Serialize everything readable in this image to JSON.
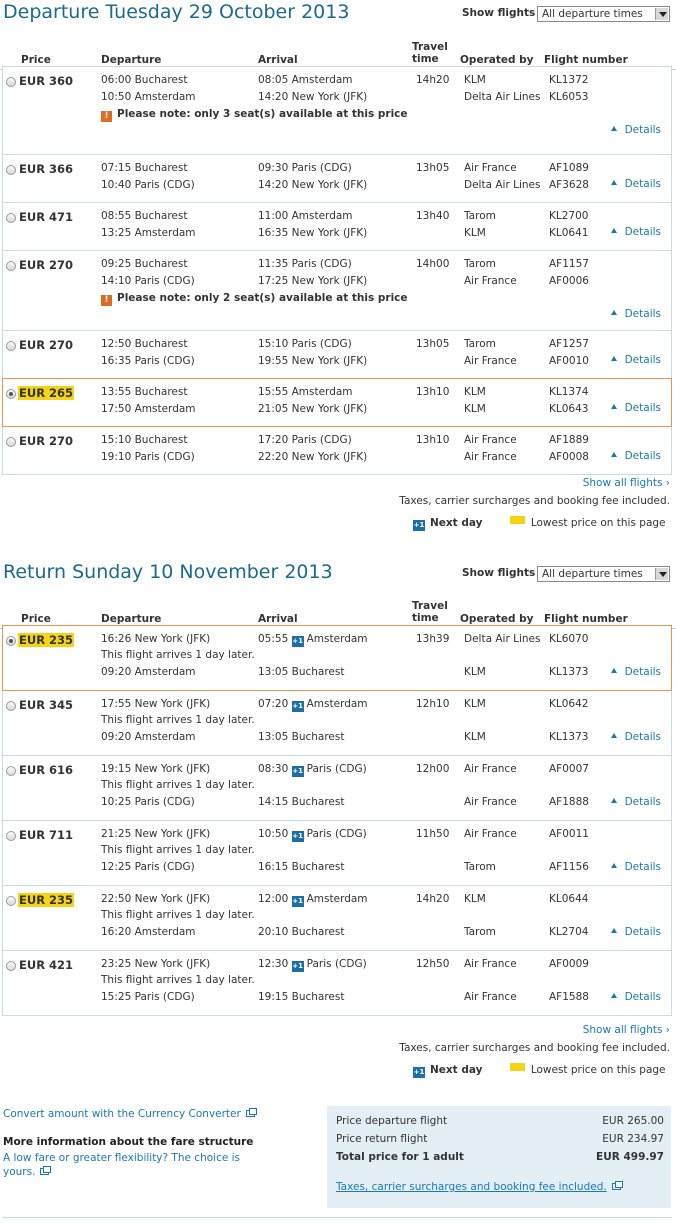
{
  "departure": {
    "title": "Departure Tuesday 29 October 2013",
    "show_flights_label": "Show flights",
    "select_value": "All departure times",
    "headers": {
      "price": "Price",
      "departure": "Departure",
      "arrival": "Arrival",
      "travel_time_1": "Travel",
      "travel_time_2": "time",
      "operated_by": "Operated by",
      "flight_number": "Flight number"
    },
    "rows": [
      {
        "price": "EUR 360",
        "lowest": false,
        "selected": false,
        "legs": [
          {
            "dep": "06:00 Bucharest",
            "arr": "08:05 Amsterdam",
            "time": "14h20",
            "op": "KLM",
            "fn": "KL1372"
          },
          {
            "dep": "10:50 Amsterdam",
            "arr": "14:20 New York (JFK)",
            "time": "",
            "op": "Delta Air Lines",
            "fn": "KL6053"
          }
        ],
        "note": "Please note: only 3 seat(s) available at this price",
        "details": "Details"
      },
      {
        "price": "EUR 366",
        "lowest": false,
        "selected": false,
        "legs": [
          {
            "dep": "07:15 Bucharest",
            "arr": "09:30 Paris (CDG)",
            "time": "13h05",
            "op": "Air France",
            "fn": "AF1089"
          },
          {
            "dep": "10:40 Paris (CDG)",
            "arr": "14:20 New York (JFK)",
            "time": "",
            "op": "Delta Air Lines",
            "fn": "AF3628"
          }
        ],
        "note": "",
        "details": "Details"
      },
      {
        "price": "EUR 471",
        "lowest": false,
        "selected": false,
        "legs": [
          {
            "dep": "08:55 Bucharest",
            "arr": "11:00 Amsterdam",
            "time": "13h40",
            "op": "Tarom",
            "fn": "KL2700"
          },
          {
            "dep": "13:25 Amsterdam",
            "arr": "16:35 New York (JFK)",
            "time": "",
            "op": "KLM",
            "fn": "KL0641"
          }
        ],
        "note": "",
        "details": "Details"
      },
      {
        "price": "EUR 270",
        "lowest": false,
        "selected": false,
        "legs": [
          {
            "dep": "09:25 Bucharest",
            "arr": "11:35 Paris (CDG)",
            "time": "14h00",
            "op": "Tarom",
            "fn": "AF1157"
          },
          {
            "dep": "14:10 Paris (CDG)",
            "arr": "17:25 New York (JFK)",
            "time": "",
            "op": "Air France",
            "fn": "AF0006"
          }
        ],
        "note": "Please note: only 2 seat(s) available at this price",
        "details": "Details"
      },
      {
        "price": "EUR 270",
        "lowest": false,
        "selected": false,
        "legs": [
          {
            "dep": "12:50 Bucharest",
            "arr": "15:10 Paris (CDG)",
            "time": "13h05",
            "op": "Tarom",
            "fn": "AF1257"
          },
          {
            "dep": "16:35 Paris (CDG)",
            "arr": "19:55 New York (JFK)",
            "time": "",
            "op": "Air France",
            "fn": "AF0010"
          }
        ],
        "note": "",
        "details": "Details"
      },
      {
        "price": "EUR 265",
        "lowest": true,
        "selected": true,
        "legs": [
          {
            "dep": "13:55 Bucharest",
            "arr": "15:55 Amsterdam",
            "time": "13h10",
            "op": "KLM",
            "fn": "KL1374"
          },
          {
            "dep": "17:50 Amsterdam",
            "arr": "21:05 New York (JFK)",
            "time": "",
            "op": "KLM",
            "fn": "KL0643"
          }
        ],
        "note": "",
        "details": "Details"
      },
      {
        "price": "EUR 270",
        "lowest": false,
        "selected": false,
        "legs": [
          {
            "dep": "15:10 Bucharest",
            "arr": "17:20 Paris (CDG)",
            "time": "13h10",
            "op": "Air France",
            "fn": "AF1889"
          },
          {
            "dep": "19:10 Paris (CDG)",
            "arr": "22:20 New York (JFK)",
            "time": "",
            "op": "Air France",
            "fn": "AF0008"
          }
        ],
        "note": "",
        "details": "Details"
      }
    ],
    "show_all": "Show all flights",
    "taxes": "Taxes, carrier surcharges and booking fee included.",
    "next_day_badge": "+1",
    "next_day": "Next day",
    "lowest_price": "Lowest price on this page"
  },
  "return": {
    "title": "Return Sunday 10 November 2013",
    "show_flights_label": "Show flights",
    "select_value": "All departure times",
    "headers": {
      "price": "Price",
      "departure": "Departure",
      "arrival": "Arrival",
      "travel_time_1": "Travel",
      "travel_time_2": "time",
      "operated_by": "Operated by",
      "flight_number": "Flight number"
    },
    "arrives_later": "This flight arrives 1 day later.",
    "rows": [
      {
        "price": "EUR 235",
        "lowest": true,
        "selected": true,
        "legs": [
          {
            "dep": "16:26 New York (JFK)",
            "arr_time": "05:55",
            "arr_place": "Amsterdam",
            "plus": true,
            "time": "13h39",
            "op": "Delta Air Lines",
            "fn": "KL6070"
          },
          {
            "dep": "09:20 Amsterdam",
            "arr_time": "13:05",
            "arr_place": "Bucharest",
            "plus": false,
            "time": "",
            "op": "KLM",
            "fn": "KL1373"
          }
        ],
        "details": "Details"
      },
      {
        "price": "EUR 345",
        "lowest": false,
        "selected": false,
        "legs": [
          {
            "dep": "17:55 New York (JFK)",
            "arr_time": "07:20",
            "arr_place": "Amsterdam",
            "plus": true,
            "time": "12h10",
            "op": "KLM",
            "fn": "KL0642"
          },
          {
            "dep": "09:20 Amsterdam",
            "arr_time": "13:05",
            "arr_place": "Bucharest",
            "plus": false,
            "time": "",
            "op": "KLM",
            "fn": "KL1373"
          }
        ],
        "details": "Details"
      },
      {
        "price": "EUR 616",
        "lowest": false,
        "selected": false,
        "legs": [
          {
            "dep": "19:15 New York (JFK)",
            "arr_time": "08:30",
            "arr_place": "Paris (CDG)",
            "plus": true,
            "time": "12h00",
            "op": "Air France",
            "fn": "AF0007"
          },
          {
            "dep": "10:25 Paris (CDG)",
            "arr_time": "14:15",
            "arr_place": "Bucharest",
            "plus": false,
            "time": "",
            "op": "Air France",
            "fn": "AF1888"
          }
        ],
        "details": "Details"
      },
      {
        "price": "EUR 711",
        "lowest": false,
        "selected": false,
        "legs": [
          {
            "dep": "21:25 New York (JFK)",
            "arr_time": "10:50",
            "arr_place": "Paris (CDG)",
            "plus": true,
            "time": "11h50",
            "op": "Air France",
            "fn": "AF0011"
          },
          {
            "dep": "12:25 Paris (CDG)",
            "arr_time": "16:15",
            "arr_place": "Bucharest",
            "plus": false,
            "time": "",
            "op": "Tarom",
            "fn": "AF1156"
          }
        ],
        "details": "Details"
      },
      {
        "price": "EUR 235",
        "lowest": true,
        "selected": false,
        "legs": [
          {
            "dep": "22:50 New York (JFK)",
            "arr_time": "12:00",
            "arr_place": "Amsterdam",
            "plus": true,
            "time": "14h20",
            "op": "KLM",
            "fn": "KL0644"
          },
          {
            "dep": "16:20 Amsterdam",
            "arr_time": "20:10",
            "arr_place": "Bucharest",
            "plus": false,
            "time": "",
            "op": "Tarom",
            "fn": "KL2704"
          }
        ],
        "details": "Details"
      },
      {
        "price": "EUR 421",
        "lowest": false,
        "selected": false,
        "legs": [
          {
            "dep": "23:25 New York (JFK)",
            "arr_time": "12:30",
            "arr_place": "Paris (CDG)",
            "plus": true,
            "time": "12h50",
            "op": "Air France",
            "fn": "AF0009"
          },
          {
            "dep": "15:25 Paris (CDG)",
            "arr_time": "19:15",
            "arr_place": "Bucharest",
            "plus": false,
            "time": "",
            "op": "Air France",
            "fn": "AF1588"
          }
        ],
        "details": "Details"
      }
    ],
    "show_all": "Show all flights",
    "taxes": "Taxes, carrier surcharges and booking fee included.",
    "next_day_badge": "+1",
    "next_day": "Next day",
    "lowest_price": "Lowest price on this page"
  },
  "footer": {
    "converter": "Convert amount with the Currency Converter",
    "fare_title": "More information about the fare structure",
    "fare_text_1": "A low fare or greater flexibility? The choice is",
    "fare_text_2": "yours.",
    "summary": {
      "dep_label": "Price departure flight",
      "dep_value": "EUR 265.00",
      "ret_label": "Price return flight",
      "ret_value": "EUR 234.97",
      "total_label": "Total price for 1 adult",
      "total_value": "EUR 499.97",
      "taxes_link": "Taxes, carrier surcharges and booking fee included."
    }
  },
  "colors": {
    "title": "#1a6a8e",
    "link": "#1a78b5",
    "lowest_highlight": "#f5d316",
    "selected_border": "#e8974a",
    "row_border": "#c5dce6",
    "summary_bg": "#e3eef5",
    "warning": "#e06b1f",
    "next_day_badge": "#1c6ea8"
  }
}
